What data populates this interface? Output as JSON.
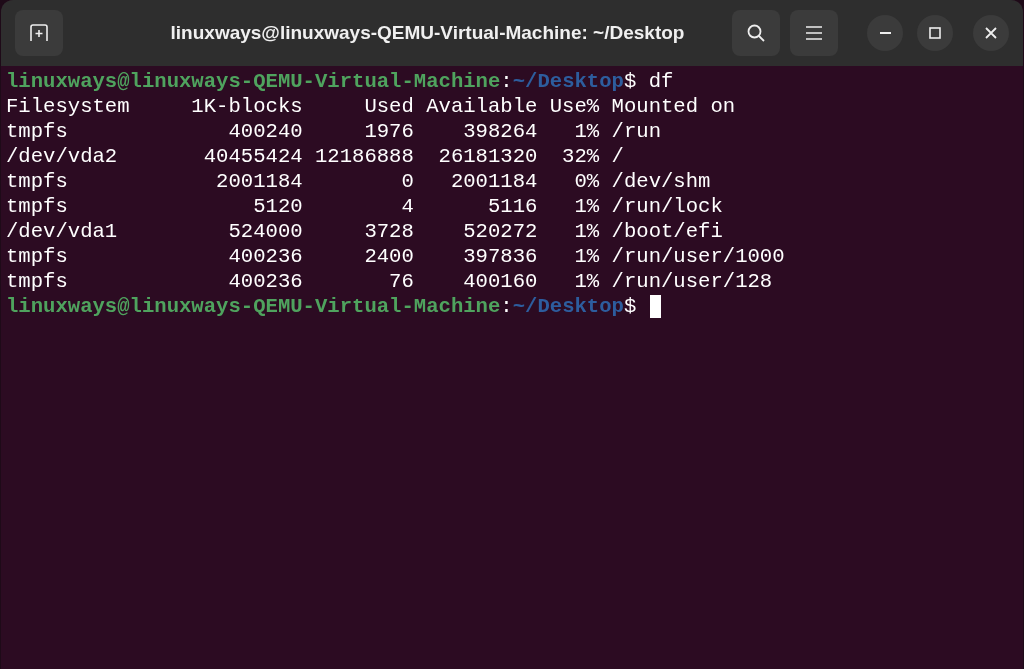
{
  "window": {
    "title": "linuxways@linuxways-QEMU-Virtual-Machine: ~/Desktop"
  },
  "terminal": {
    "entries": [
      {
        "kind": "prompt",
        "user_host": "linuxways@linuxways-QEMU-Virtual-Machine",
        "separator": ":",
        "path": "~/Desktop",
        "symbol": "$",
        "command": "df",
        "cursor": false
      },
      {
        "kind": "output",
        "text": "Filesystem     1K-blocks     Used Available Use% Mounted on"
      },
      {
        "kind": "output",
        "text": "tmpfs             400240     1976    398264   1% /run"
      },
      {
        "kind": "output",
        "text": "/dev/vda2       40455424 12186888  26181320  32% /"
      },
      {
        "kind": "output",
        "text": "tmpfs            2001184        0   2001184   0% /dev/shm"
      },
      {
        "kind": "output",
        "text": "tmpfs               5120        4      5116   1% /run/lock"
      },
      {
        "kind": "output",
        "text": "/dev/vda1         524000     3728    520272   1% /boot/efi"
      },
      {
        "kind": "output",
        "text": "tmpfs             400236     2400    397836   1% /run/user/1000"
      },
      {
        "kind": "output",
        "text": "tmpfs             400236       76    400160   1% /run/user/128"
      },
      {
        "kind": "prompt",
        "user_host": "linuxways@linuxways-QEMU-Virtual-Machine",
        "separator": ":",
        "path": "~/Desktop",
        "symbol": "$",
        "cursor": true
      }
    ]
  }
}
